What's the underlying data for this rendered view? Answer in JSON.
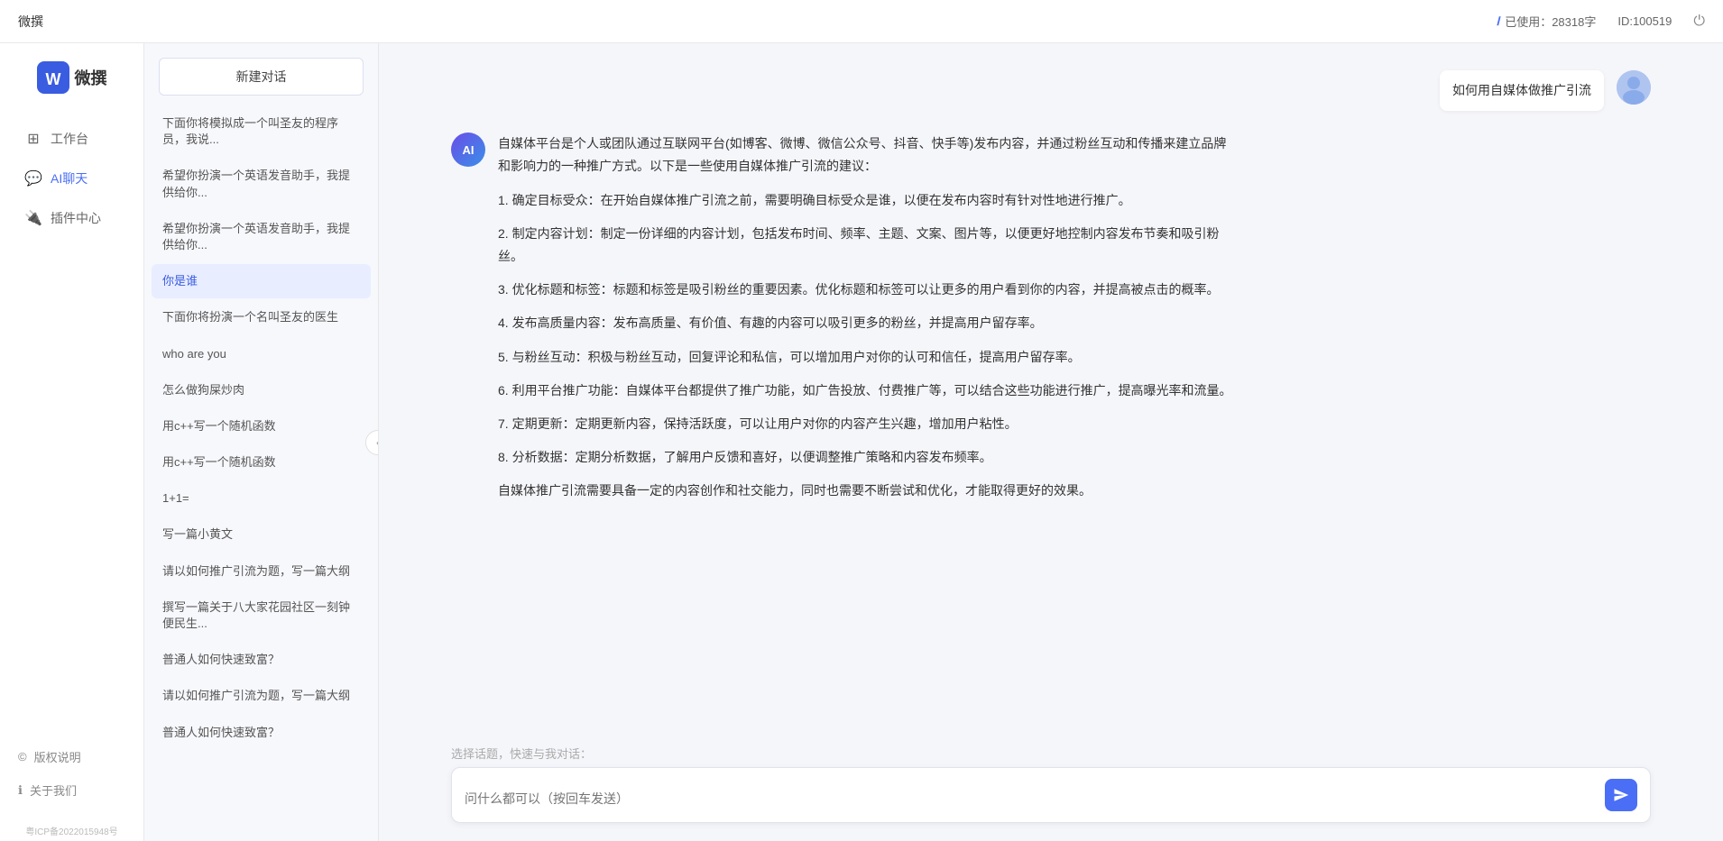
{
  "topbar": {
    "title": "微撰",
    "usage_label": "已使用：28318字",
    "id_label": "ID:100519",
    "info_icon": "ℹ",
    "logout_icon": "⏻"
  },
  "logo": {
    "text": "微撰"
  },
  "sidebar": {
    "nav_items": [
      {
        "id": "workbench",
        "icon": "⊞",
        "label": "工作台"
      },
      {
        "id": "ai-chat",
        "icon": "💬",
        "label": "AI聊天",
        "active": true
      },
      {
        "id": "plugin",
        "icon": "🔌",
        "label": "插件中心"
      }
    ],
    "bottom_items": [
      {
        "id": "copyright",
        "icon": "©",
        "label": "版权说明"
      },
      {
        "id": "about",
        "icon": "ℹ",
        "label": "关于我们"
      }
    ],
    "beian": "粤ICP备2022015948号"
  },
  "chat_list": {
    "new_chat_label": "新建对话",
    "items": [
      {
        "id": "c1",
        "text": "下面你将模拟成一个叫圣友的程序员，我说..."
      },
      {
        "id": "c2",
        "text": "希望你扮演一个英语发音助手，我提供给你..."
      },
      {
        "id": "c3",
        "text": "希望你扮演一个英语发音助手，我提供给你..."
      },
      {
        "id": "c4",
        "text": "你是谁",
        "active": true
      },
      {
        "id": "c5",
        "text": "下面你将扮演一个名叫圣友的医生"
      },
      {
        "id": "c6",
        "text": "who are you"
      },
      {
        "id": "c7",
        "text": "怎么做狗屎炒肉"
      },
      {
        "id": "c8",
        "text": "用c++写一个随机函数"
      },
      {
        "id": "c9",
        "text": "用c++写一个随机函数"
      },
      {
        "id": "c10",
        "text": "1+1="
      },
      {
        "id": "c11",
        "text": "写一篇小黄文"
      },
      {
        "id": "c12",
        "text": "请以如何推广引流为题，写一篇大纲"
      },
      {
        "id": "c13",
        "text": "撰写一篇关于八大家花园社区一刻钟便民生..."
      },
      {
        "id": "c14",
        "text": "普通人如何快速致富？"
      },
      {
        "id": "c15",
        "text": "请以如何推广引流为题，写一篇大纲"
      },
      {
        "id": "c16",
        "text": "普通人如何快速致富？"
      }
    ]
  },
  "chat": {
    "user_message": "如何用自媒体做推广引流",
    "ai_response": {
      "paragraphs": [
        "自媒体平台是个人或团队通过互联网平台(如博客、微博、微信公众号、抖音、快手等)发布内容，并通过粉丝互动和传播来建立品牌和影响力的一种推广方式。以下是一些使用自媒体推广引流的建议：",
        "1. 确定目标受众：在开始自媒体推广引流之前，需要明确目标受众是谁，以便在发布内容时有针对性地进行推广。",
        "2. 制定内容计划：制定一份详细的内容计划，包括发布时间、频率、主题、文案、图片等，以便更好地控制内容发布节奏和吸引粉丝。",
        "3. 优化标题和标签：标题和标签是吸引粉丝的重要因素。优化标题和标签可以让更多的用户看到你的内容，并提高被点击的概率。",
        "4. 发布高质量内容：发布高质量、有价值、有趣的内容可以吸引更多的粉丝，并提高用户留存率。",
        "5. 与粉丝互动：积极与粉丝互动，回复评论和私信，可以增加用户对你的认可和信任，提高用户留存率。",
        "6. 利用平台推广功能：自媒体平台都提供了推广功能，如广告投放、付费推广等，可以结合这些功能进行推广，提高曝光率和流量。",
        "7. 定期更新：定期更新内容，保持活跃度，可以让用户对你的内容产生兴趣，增加用户粘性。",
        "8. 分析数据：定期分析数据，了解用户反馈和喜好，以便调整推广策略和内容发布频率。",
        "自媒体推广引流需要具备一定的内容创作和社交能力，同时也需要不断尝试和优化，才能取得更好的效果。"
      ]
    },
    "quick_reply_placeholder": "选择话题，快速与我对话：",
    "input_placeholder": "问什么都可以（按回车发送）"
  }
}
